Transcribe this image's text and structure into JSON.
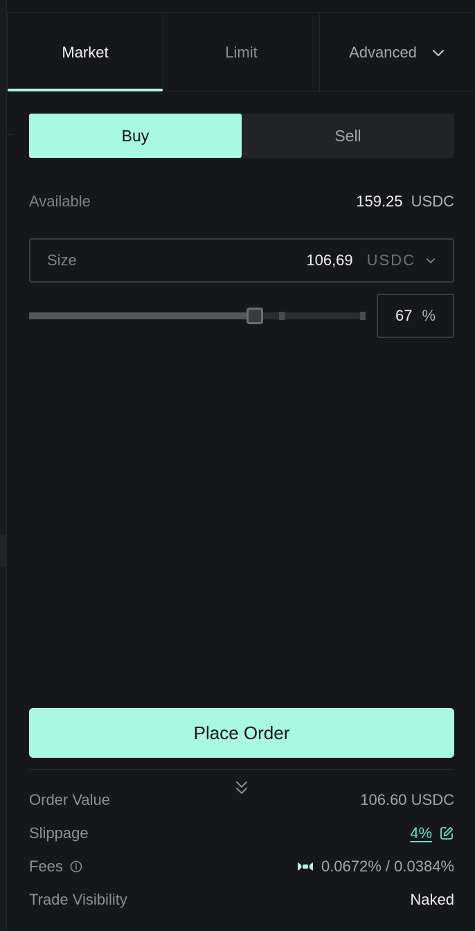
{
  "tabs": [
    {
      "label": "Market",
      "active": true
    },
    {
      "label": "Limit",
      "active": false
    },
    {
      "label": "Advanced",
      "active": false
    }
  ],
  "side": {
    "buy_label": "Buy",
    "sell_label": "Sell",
    "selected": "Buy"
  },
  "available": {
    "label": "Available",
    "value": "159.25",
    "unit": "USDC"
  },
  "size": {
    "label": "Size",
    "value": "106,69",
    "unit": "USDC"
  },
  "slider": {
    "percent_value": 67,
    "percent_text": "67",
    "percent_symbol": "%"
  },
  "place_order": {
    "label": "Place Order"
  },
  "summary": {
    "order_value": {
      "label": "Order Value",
      "value": "106.60 USDC"
    },
    "slippage": {
      "label": "Slippage",
      "value": "4%"
    },
    "fees": {
      "label": "Fees",
      "value": "0.0672% / 0.0384%"
    },
    "trade_visibility": {
      "label": "Trade Visibility",
      "value": "Naked"
    }
  },
  "colors": {
    "accent": "#a8f8e2",
    "background": "#16171b",
    "link": "#6fe0c6"
  },
  "icons": [
    "chevron-down-icon",
    "chevrons-down-icon",
    "info-icon",
    "edit-icon",
    "fee-tier-icon"
  ]
}
